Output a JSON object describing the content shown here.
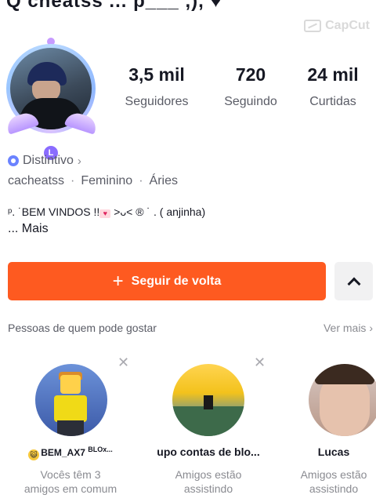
{
  "top_ghost_text": "Q cheatss ... p___ ,), ♥",
  "watermark": {
    "text": "CapCut",
    "icon": "capcut-logo"
  },
  "profile": {
    "avatar_icon": "profile-avatar-with-frame",
    "frame_gem_label": "L",
    "stats": [
      {
        "value": "3,5 mil",
        "label": "Seguidores"
      },
      {
        "value": "720",
        "label": "Seguindo"
      },
      {
        "value": "24 mil",
        "label": "Curtidas"
      }
    ],
    "badge_label": "Distintivo",
    "badge_chevron": "›",
    "tags": [
      "cacheatss",
      "Feminino",
      "Áries"
    ],
    "tag_separator": "·",
    "bio_line": "ᵖ. ˙BEM VINDOS !!",
    "bio_heart": "♥",
    "bio_line_end": " >ᴗ< ® ˙ . ( anjinha)",
    "bio_more": "... Mais"
  },
  "actions": {
    "follow_back_plus": "+",
    "follow_back_label": "Seguir de volta",
    "expand_icon": "chevron-up-icon"
  },
  "suggestions": {
    "title": "Pessoas de quem pode gostar",
    "see_more": "Ver mais",
    "see_more_chevron": "›",
    "dismiss_icon": "✕",
    "cards": [
      {
        "name": "BEM_AX7",
        "name_sup": "BLOx...",
        "emoji": "😺",
        "subtitle_1": "Vocês têm 3",
        "subtitle_2": "amigos em comum"
      },
      {
        "name": "upo contas de blo...",
        "subtitle_1": "Amigos estão",
        "subtitle_2": "assistindo"
      },
      {
        "name": "Lucas",
        "subtitle_1": "Amigos estão",
        "subtitle_2": "assistindo"
      }
    ]
  },
  "colors": {
    "accent": "#fe5a20",
    "text_primary": "#161823",
    "text_secondary": "#5a5c66",
    "badge_blue": "#6b83ff"
  }
}
